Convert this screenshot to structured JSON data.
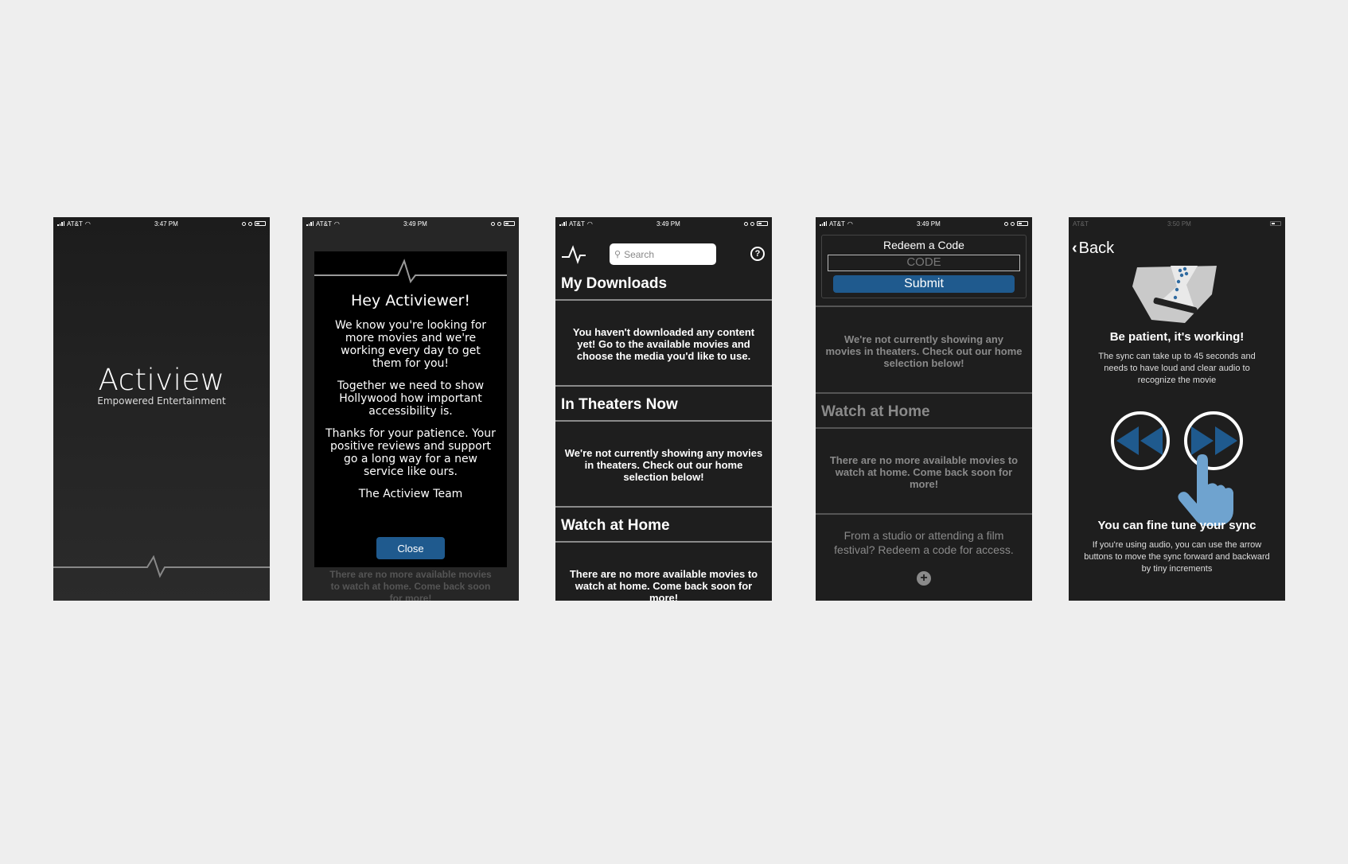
{
  "status": {
    "carrier": "AT&T",
    "times": [
      "3:47 PM",
      "3:49 PM",
      "3:49 PM",
      "3:49 PM",
      "3:50 PM"
    ]
  },
  "splash": {
    "brand": "Actiview",
    "tagline": "Empowered Entertainment"
  },
  "welcome_modal": {
    "title": "Hey Activiewer!",
    "para1": "We know you're looking for more movies and we're working every day to get them for you!",
    "para2": "Together we need to show Hollywood how important accessibility is.",
    "para3": "Thanks for your patience. Your positive reviews and support go a long way for a new service like ours.",
    "signature": "The Actiview Team",
    "close_label": "Close",
    "background_text": "There are no more available movies to watch at home. Come back soon for more!"
  },
  "home": {
    "search_placeholder": "Search",
    "help_label": "?",
    "downloads_title": "My Downloads",
    "downloads_msg": "You haven't downloaded any content yet! Go to the available movies and choose the media you'd like to use.",
    "theaters_title": "In Theaters Now",
    "theaters_msg": "We're not currently showing any movies in theaters. Check out our home selection below!",
    "home_title": "Watch at Home",
    "home_msg": "There are no more available movies to watch at home. Come back soon for more!"
  },
  "redeem": {
    "title": "Redeem a Code",
    "code_placeholder": "CODE",
    "submit_label": "Submit",
    "theaters_msg": "We're not currently showing any movies in theaters. Check out our home selection below!",
    "home_title": "Watch at Home",
    "home_msg": "There are no more available movies to watch at home. Come back soon for more!",
    "studio_msg": "From a studio or attending a film festival? Redeem a code for access.",
    "add_label": "+"
  },
  "sync": {
    "back_label": "Back",
    "patience_title": "Be patient, it's working!",
    "patience_text": "The sync can take up to 45 seconds and needs to have loud and clear audio to recognize the movie",
    "tune_title": "You can fine tune your sync",
    "tune_text": "If you're using audio, you can use the arrow buttons to move the sync forward and backward by tiny increments"
  },
  "colors": {
    "accent": "#1f5a8e",
    "screen_bg": "#1e1e1e",
    "page_bg": "#eeeeee",
    "hand": "#6fa3cf"
  }
}
